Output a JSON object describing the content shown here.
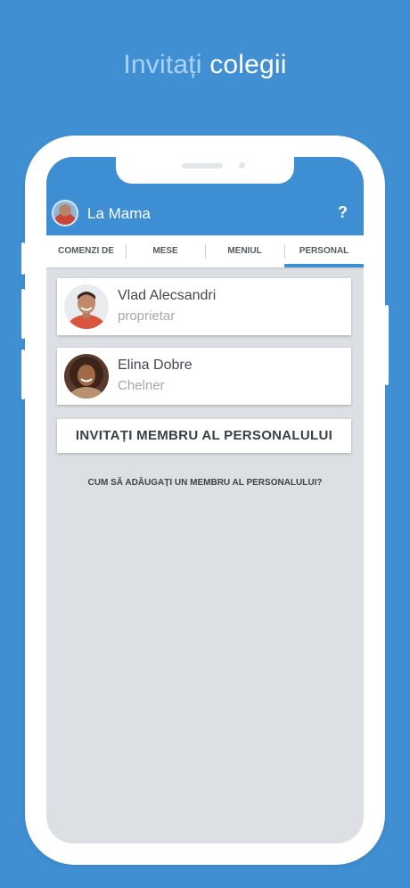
{
  "headline": {
    "word1": "Invitați",
    "word2": "colegii"
  },
  "colors": {
    "background": "#3f8fd2",
    "accent": "#3d8ed3",
    "headline_light": "#a9d1f7"
  },
  "appbar": {
    "title": "La Mama",
    "help_label": "?",
    "avatar_icon": "user-avatar"
  },
  "tabs": [
    {
      "label": "COMENZI DE",
      "active": false
    },
    {
      "label": "MESE",
      "active": false
    },
    {
      "label": "MENIUL",
      "active": false
    },
    {
      "label": "PERSONAL",
      "active": true
    }
  ],
  "staff": [
    {
      "name": "Vlad Alecsandri",
      "role": "proprietar"
    },
    {
      "name": "Elina Dobre",
      "role": "Chelner"
    }
  ],
  "invite_button": "INVITAȚI MEMBRU AL PERSONALULUI",
  "howto_link": "CUM SĂ ADĂUGAȚI UN MEMBRU AL PERSONALULUI?"
}
